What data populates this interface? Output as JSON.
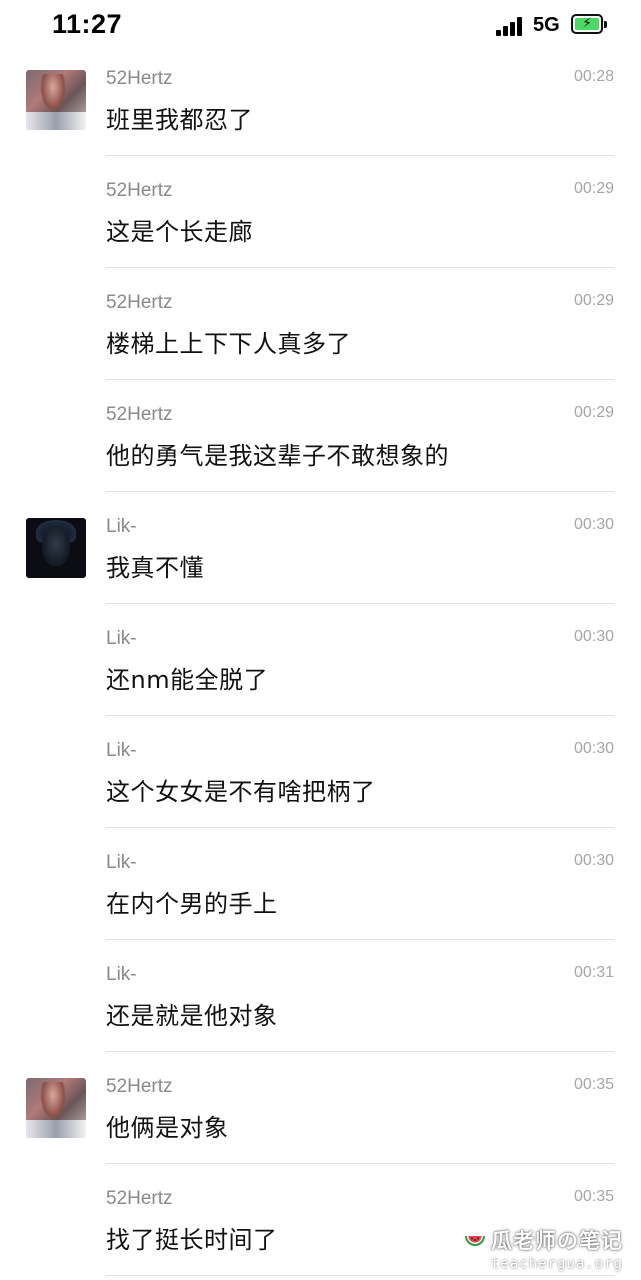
{
  "status_bar": {
    "time": "11:27",
    "network": "5G",
    "battery_color": "#4cd964"
  },
  "messages": [
    {
      "sender": "52Hertz",
      "time": "00:28",
      "text": "班里我都忍了",
      "avatar": "52hertz-avatar"
    },
    {
      "sender": "52Hertz",
      "time": "00:29",
      "text": "这是个长走廊",
      "avatar": null
    },
    {
      "sender": "52Hertz",
      "time": "00:29",
      "text": "楼梯上上下下人真多了",
      "avatar": null
    },
    {
      "sender": "52Hertz",
      "time": "00:29",
      "text": "他的勇气是我这辈子不敢想象的",
      "avatar": null
    },
    {
      "sender": "Lik-",
      "time": "00:30",
      "text": "我真不懂",
      "avatar": "lik-avatar"
    },
    {
      "sender": "Lik-",
      "time": "00:30",
      "text": "还nm能全脱了",
      "avatar": null
    },
    {
      "sender": "Lik-",
      "time": "00:30",
      "text": "这个女女是不有啥把柄了",
      "avatar": null
    },
    {
      "sender": "Lik-",
      "time": "00:30",
      "text": "在内个男的手上",
      "avatar": null
    },
    {
      "sender": "Lik-",
      "time": "00:31",
      "text": "还是就是他对象",
      "avatar": null
    },
    {
      "sender": "52Hertz",
      "time": "00:35",
      "text": "他俩是对象",
      "avatar": "52hertz-avatar"
    },
    {
      "sender": "52Hertz",
      "time": "00:35",
      "text": "找了挺长时间了",
      "avatar": null
    }
  ],
  "watermark": {
    "title": "瓜老师の笔记",
    "url": "teachergua.org",
    "icon": "watermelon-icon"
  }
}
